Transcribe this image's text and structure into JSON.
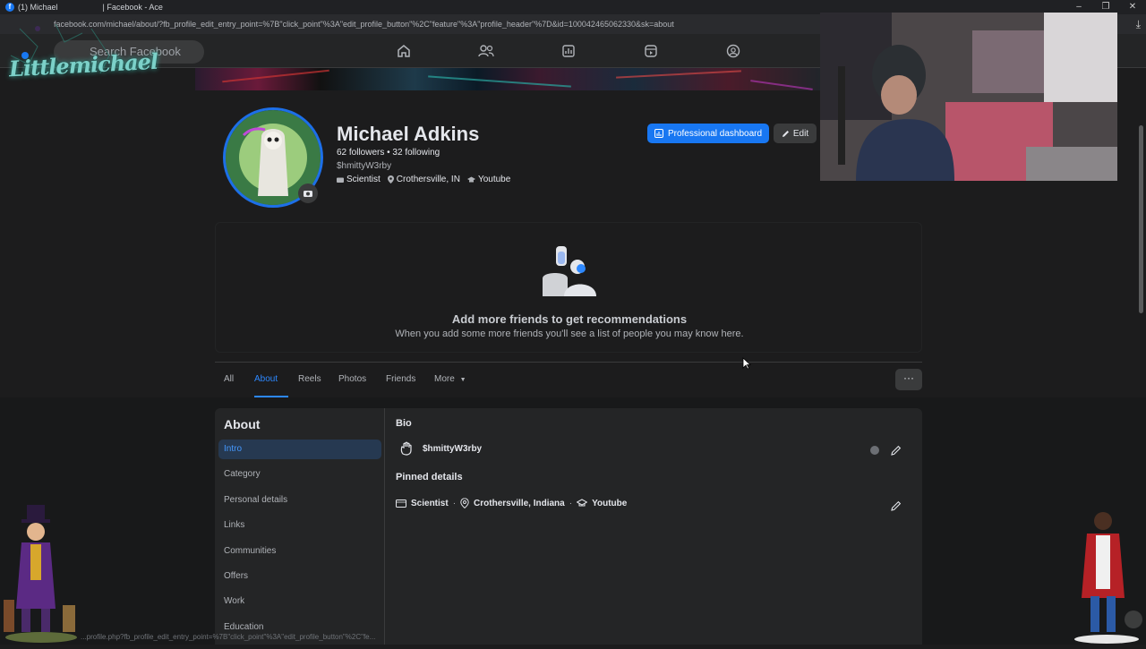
{
  "browser": {
    "tab_title": "(1) Michael",
    "window_title": "| Facebook - Ace",
    "url": "facebook.com/michael/about/?fb_profile_edit_entry_point=%7B\"click_point\"%3A\"edit_profile_button\"%2C\"feature\"%3A\"profile_header\"%7D&id=100042465062330&sk=about",
    "status_url": "...profile.php?fb_profile_edit_entry_point=%7B\"click_point\"%3A\"edit_profile_button\"%2C\"fe..."
  },
  "overlay": {
    "logo_text": "Littlemichael"
  },
  "topnav": {
    "search_placeholder": "Search Facebook"
  },
  "profile": {
    "name": "Michael Adkins",
    "stats": "62 followers • 32 following",
    "handle": "$hmittyW3rby",
    "category": "Scientist",
    "location": "Crothersville, IN",
    "education": "Youtube",
    "professional_dashboard_label": "Professional dashboard",
    "edit_label": "Edit"
  },
  "recommendations": {
    "title": "Add more friends to get recommendations",
    "subtitle": "When you add some more friends you'll see a list of people you may know here."
  },
  "tabs": [
    {
      "label": "All"
    },
    {
      "label": "About"
    },
    {
      "label": "Reels"
    },
    {
      "label": "Photos"
    },
    {
      "label": "Friends"
    },
    {
      "label": "More"
    }
  ],
  "about": {
    "heading": "About",
    "nav": [
      {
        "label": "Intro"
      },
      {
        "label": "Category"
      },
      {
        "label": "Personal details"
      },
      {
        "label": "Links"
      },
      {
        "label": "Communities"
      },
      {
        "label": "Offers"
      },
      {
        "label": "Work"
      },
      {
        "label": "Education"
      }
    ],
    "bio_heading": "Bio",
    "bio_text": "$hmittyW3rby",
    "pinned_heading": "Pinned details",
    "pinned": {
      "category": "Scientist",
      "location": "Crothersville, Indiana",
      "education": "Youtube"
    }
  },
  "colors": {
    "accent": "#1877f2",
    "link": "#2d88ff",
    "background": "#18191a",
    "card": "#242526"
  }
}
